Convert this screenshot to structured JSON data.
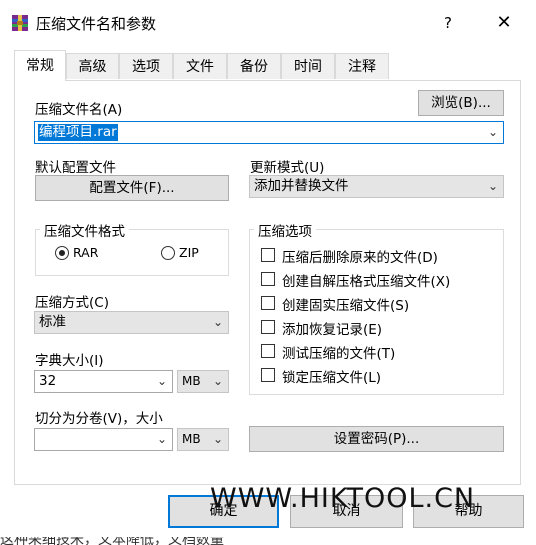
{
  "window": {
    "title": "压缩文件名和参数",
    "help_label": "?",
    "close_label": "✕"
  },
  "tabs": [
    "常规",
    "高级",
    "选项",
    "文件",
    "备份",
    "时间",
    "注释"
  ],
  "general": {
    "archive_name_label": "压缩文件名(A)",
    "browse_label": "浏览(B)...",
    "archive_name_value": "编程项目.rar",
    "default_profile_label": "默认配置文件",
    "profile_button_label": "配置文件(F)...",
    "update_mode_label": "更新模式(U)",
    "update_mode_value": "添加并替换文件",
    "format_group_label": "压缩文件格式",
    "format_rar": "RAR",
    "format_zip": "ZIP",
    "selected_format": "RAR",
    "method_label": "压缩方式(C)",
    "method_value": "标准",
    "dict_label": "字典大小(I)",
    "dict_value": "32",
    "dict_unit": "MB",
    "split_label": "切分为分卷(V)，大小",
    "split_value": "",
    "split_unit": "MB",
    "options_group_label": "压缩选项",
    "options": [
      {
        "label": "压缩后删除原来的文件(D)",
        "checked": false
      },
      {
        "label": "创建自解压格式压缩文件(X)",
        "checked": false
      },
      {
        "label": "创建固实压缩文件(S)",
        "checked": false
      },
      {
        "label": "添加恢复记录(E)",
        "checked": false
      },
      {
        "label": "测试压缩的文件(T)",
        "checked": false
      },
      {
        "label": "锁定压缩文件(L)",
        "checked": false
      }
    ],
    "password_button_label": "设置密码(P)..."
  },
  "footer": {
    "ok_label": "确定",
    "cancel_label": "取消",
    "help_label": "帮助"
  },
  "watermark": "WWW.HIKTOOL.CN",
  "bottom_strip_text": "这种采细技米，文本降低，文档数量"
}
